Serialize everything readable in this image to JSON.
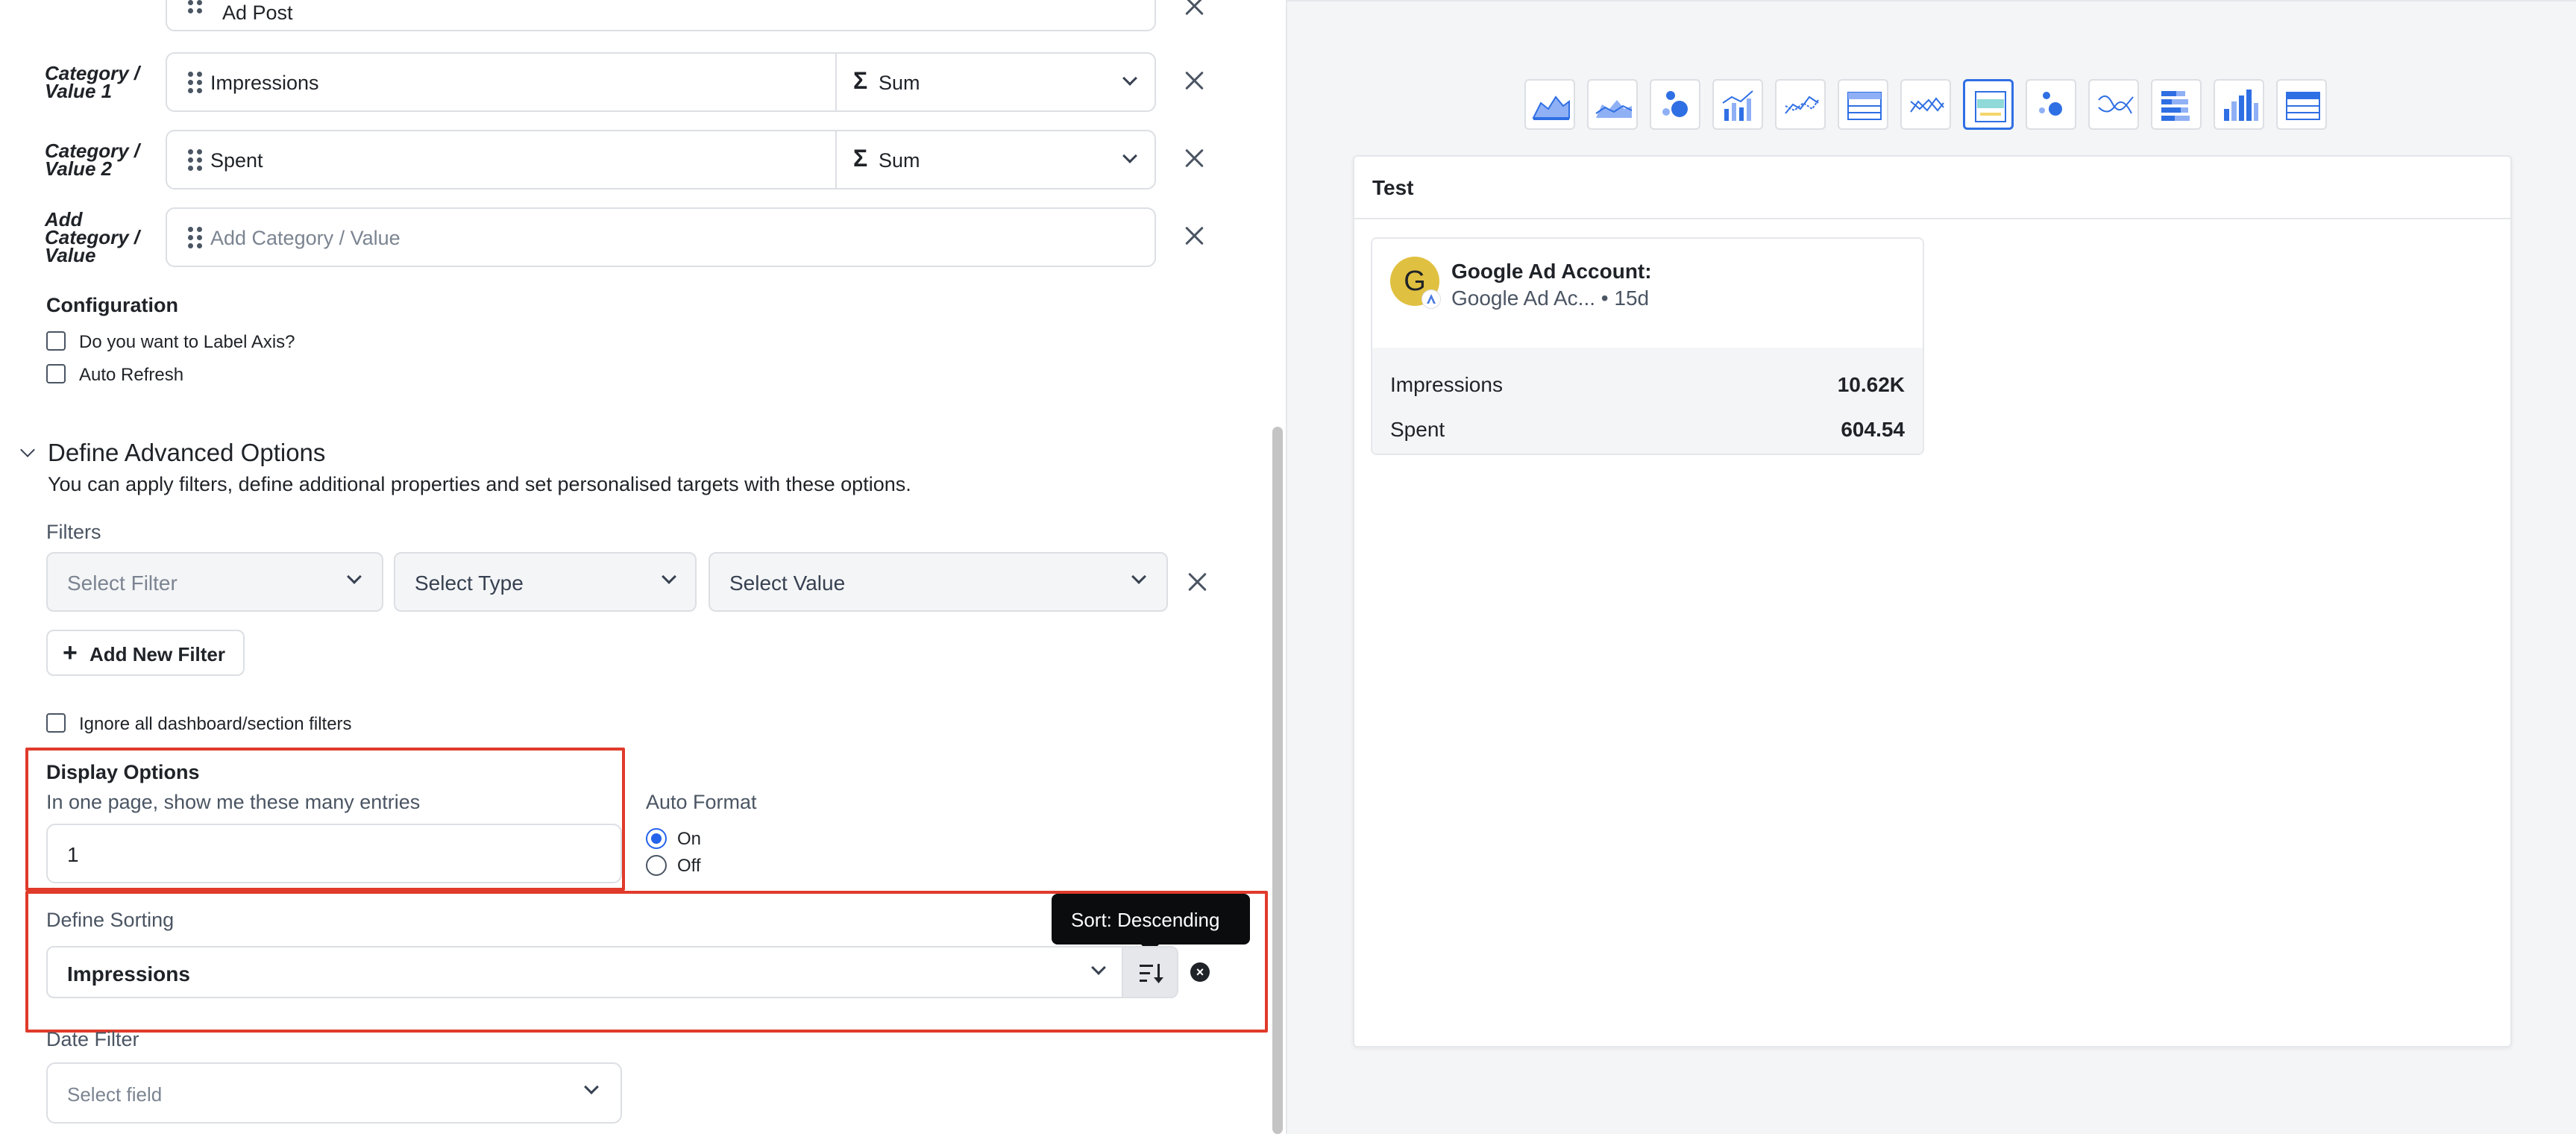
{
  "fields": {
    "top_partial": {
      "value": "Ad Post"
    },
    "value1": {
      "label": "Category / Value 1",
      "label_line1": "Category /",
      "label_line2": "Value 1",
      "field": "Impressions",
      "aggregation": "Sum"
    },
    "value2": {
      "label": "Category / Value 2",
      "label_line1": "Category /",
      "label_line2": "Value 2",
      "field": "Spent",
      "aggregation": "Sum"
    },
    "add": {
      "label_line1": "Add",
      "label_line2": "Category /",
      "label_line3": "Value",
      "placeholder": "Add Category / Value"
    }
  },
  "configuration": {
    "title": "Configuration",
    "label_axis": {
      "label": "Do you want to Label Axis?",
      "checked": false
    },
    "auto_refresh": {
      "label": "Auto Refresh",
      "checked": false
    }
  },
  "advanced": {
    "title": "Define Advanced Options",
    "description": "You can apply filters, define additional properties and set personalised targets with these options.",
    "filters_label": "Filters",
    "select_filter": "Select Filter",
    "select_type": "Select Type",
    "select_value": "Select Value",
    "add_filter_button": "Add New Filter",
    "ignore_filters": {
      "label": "Ignore all dashboard/section filters",
      "checked": false
    }
  },
  "display_options": {
    "title": "Display Options",
    "description": "In one page, show me these many entries",
    "entries_value": "1"
  },
  "auto_format": {
    "title": "Auto Format",
    "options": [
      "On",
      "Off"
    ],
    "selected": "On"
  },
  "sorting": {
    "title": "Define Sorting",
    "field": "Impressions",
    "tooltip": "Sort: Descending"
  },
  "date_filter": {
    "title": "Date Filter",
    "placeholder": "Select field"
  },
  "preview": {
    "chart_types": [
      "area",
      "stacked-area",
      "bubble",
      "bar-line",
      "line",
      "table",
      "multi-line",
      "summary-card",
      "scatter",
      "spline",
      "stacked-bar",
      "column",
      "grid"
    ],
    "active_chart_type": "summary-card",
    "widget_title": "Test",
    "card": {
      "avatar_letter": "G",
      "account_name": "Google Ad Account:",
      "account_sub": "Google Ad Ac... • 15d",
      "metrics": [
        {
          "name": "Impressions",
          "value": "10.62K"
        },
        {
          "name": "Spent",
          "value": "604.54"
        }
      ]
    }
  },
  "colors": {
    "accent": "#2f6fe4",
    "highlight": "#e03a2b",
    "avatar": "#e0c040"
  }
}
